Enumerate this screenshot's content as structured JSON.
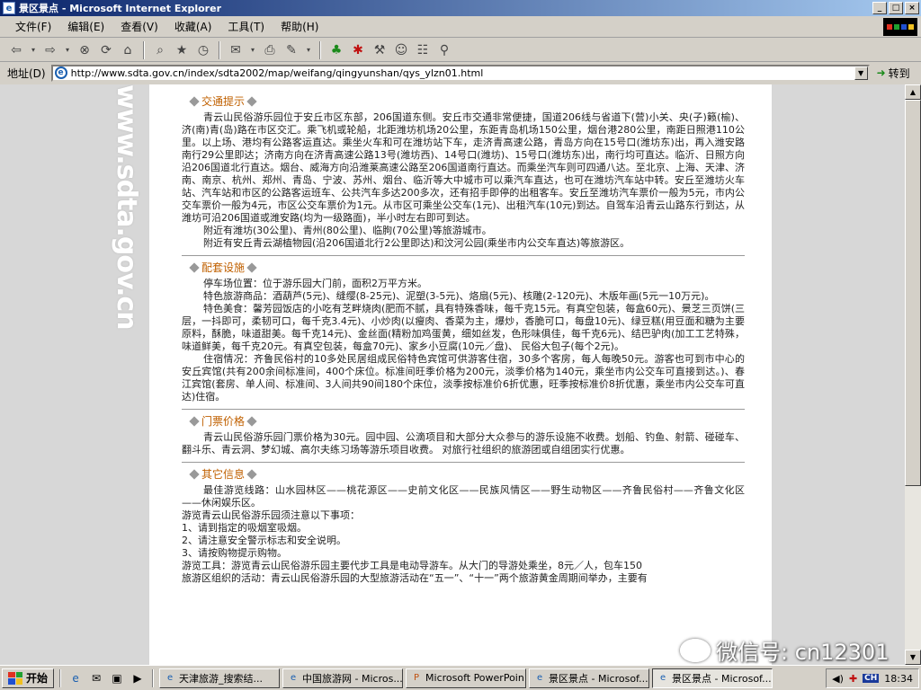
{
  "window": {
    "title": "景区景点 - Microsoft Internet Explorer",
    "buttons": {
      "minimize": "_",
      "maximize": "□",
      "close": "×"
    }
  },
  "menu": [
    "文件(F)",
    "编辑(E)",
    "查看(V)",
    "收藏(A)",
    "工具(T)",
    "帮助(H)"
  ],
  "address": {
    "label": "地址(D)",
    "url": "http://www.sdta.gov.cn/index/sdta2002/map/weifang/qingyunshan/qys_ylzn01.html",
    "go": "转到"
  },
  "watermark": "www.sdta.gov.cn",
  "sections": {
    "traffic": {
      "title": "交通提示",
      "p1": "青云山民俗游乐园位于安丘市区东部，206国道东侧。安丘市交通非常便捷，国道206线与省道下(营)小关、央(子)籁(榆)、济(南)青(岛)路在市区交汇。乘飞机或轮船，北距潍坊机场20公里，东距青岛机场150公里，烟台港280公里，南距日照港110公里。以上场、港均有公路客运直达。乘坐火车和可在潍坊站下车，走济青高速公路，青岛方向在15号口(潍坊东)出，再入潍安路南行29公里即达；济南方向在济青高速公路13号(潍坊西)、14号口(潍坊)、15号口(潍坊东)出，南行均可直达。临沂、日照方向沿206国道北行直达。烟台、威海方向沿潍莱高速公路至206国道南行直达。而乘坐汽车则可四通八达。至北京、上海、天津、济南、南京、杭州、郑州、青岛、宁波、苏州、烟台、临沂等大中城市可以乘汽车直达，也可在潍坊汽车站中转。安丘至潍坊火车站、汽车站和市区的公路客运班车、公共汽车多达200多次，还有招手即停的出租客车。安丘至潍坊汽车票价一般为5元，市内公交车票价一般为4元，市区公交车票价为1元。从市区可乘坐公交车(1元)、出租汽车(10元)到达。自驾车沿青云山路东行到达，从潍坊可沿206国道或潍安路(均为一级路面)，半小时左右即可到达。",
      "p2": "附近有潍坊(30公里)、青州(80公里)、临朐(70公里)等旅游城市。",
      "p3": "附近有安丘青云湖植物园(沿206国道北行2公里即达)和汶河公园(乘坐市内公交车直达)等旅游区。"
    },
    "facilities": {
      "title": "配套设施",
      "p1": "停车场位置：位于游乐园大门前，面积2万平方米。",
      "p2": "特色旅游商品：酒葫芦(5元)、缝缨(8-25元)、泥塑(3-5元)、烙扇(5元)、核雕(2-120元)、木版年画(5元一10万元)。",
      "p3": "特色美食：馨芳园饭店的小吃有芝畔烧肉(肥而不腻，具有特殊香味，每千克15元。有真空包装，每盒60元)、景芝三页饼(三层，一抖即可，柔韧可口，每千克3.4元)、小炒肉(以瘦肉、香菜为主，爆炒，香脆可口，每盘10元)、绿豆糕(用豆面和糖为主要原料，酥脆，味道甜美。每千克14元)、金丝面(精粉加鸡蛋黄，细如丝发，色形味俱佳，每千克6元)、结巴驴肉(加工工艺特殊，味道鲜美，每千克20元。有真空包装，每盒70元)、家乡小豆腐(10元／盘)、 民俗大包子(每个2元)。",
      "p4": "住宿情况：齐鲁民俗村的10多处民居组成民俗特色宾馆可供游客住宿，30多个客房，每人每晚50元。游客也可到市中心的安丘宾馆(共有200余间标准间，400个床位。标准间旺季价格为200元，淡季价格为140元，乘坐市内公交车可直接到达。)、春江宾馆(套房、单人间、标准间、3人间共90间180个床位，淡季按标准价6折优惠，旺季按标准价8折优惠，乘坐市内公交车可直达)住宿。"
    },
    "tickets": {
      "title": "门票价格",
      "p1": "青云山民俗游乐园门票价格为30元。园中园、公滴项目和大部分大众参与的游乐设施不收费。划船、钓鱼、射箭、碰碰车、翻斗乐、青云洞、梦幻城、高尔夫练习场等游乐项目收费。 对旅行社组织的旅游团或自组团实行优惠。"
    },
    "other": {
      "title": "其它信息",
      "p1": "最佳游览线路：山水园林区——桃花源区——史前文化区——民族风情区——野生动物区——齐鲁民俗村——齐鲁文化区——休闲娱乐区。",
      "p2": "游览青云山民俗游乐园须注意以下事项：",
      "l1": "1、请到指定的吸烟室吸烟。",
      "l2": "2、请注意安全警示标志和安全说明。",
      "l3": "3、请按购物提示购物。",
      "p3": "游览工具：游览青云山民俗游乐园主要代步工具是电动导游车。从大门的导游处乘坐，8元／人，包车150",
      "p4": "旅游区组织的活动：青云山民俗游乐园的大型旅游活动在“五一”、“十一”两个旅游黄金周期间举办，主要有"
    }
  },
  "wechat": "微信号: cn12301",
  "taskbar": {
    "start": "开始",
    "tasks": [
      "天津旅游_搜索结...",
      "中国旅游网 - Micros...",
      "Microsoft PowerPoin...",
      "景区景点 - Microsof...",
      "景区景点 - Microsof..."
    ],
    "clock": "18:34",
    "ime": "CH"
  }
}
